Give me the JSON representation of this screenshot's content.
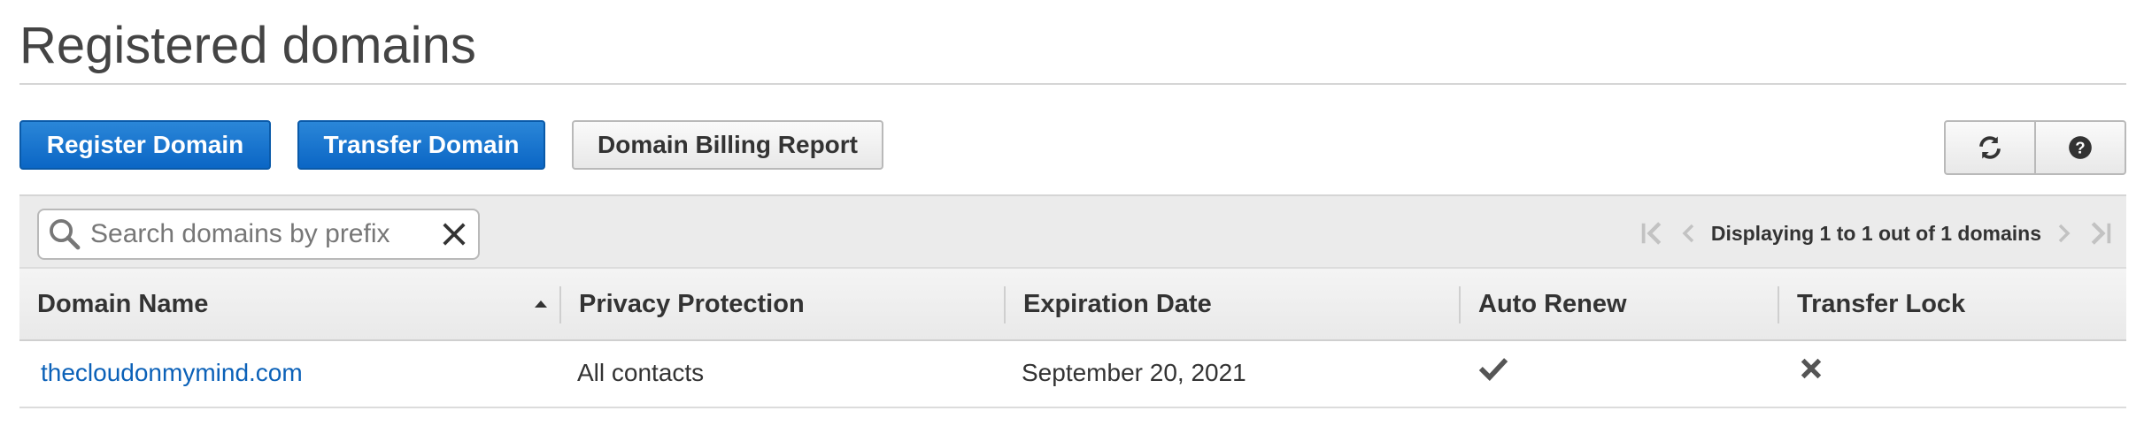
{
  "page": {
    "title": "Registered domains"
  },
  "toolbar": {
    "register_label": "Register Domain",
    "transfer_label": "Transfer Domain",
    "billing_label": "Domain Billing Report",
    "refresh_icon": "refresh-icon",
    "help_icon": "help-icon"
  },
  "search": {
    "value": "",
    "placeholder": "Search domains by prefix"
  },
  "pagination": {
    "text": "Displaying 1 to 1 out of 1 domains"
  },
  "table": {
    "columns": [
      "Domain Name",
      "Privacy Protection",
      "Expiration Date",
      "Auto Renew",
      "Transfer Lock"
    ],
    "sorted_column": "Domain Name",
    "sort_direction": "ascending",
    "rows": [
      {
        "domain": "thecloudonmymind.com",
        "privacy": "All contacts",
        "expiration": "September 20, 2021",
        "auto_renew": "check-icon",
        "transfer_lock": "x-icon"
      }
    ]
  },
  "colors": {
    "primary": "#0b66c5",
    "link": "#0b61b8",
    "text": "#333333"
  }
}
